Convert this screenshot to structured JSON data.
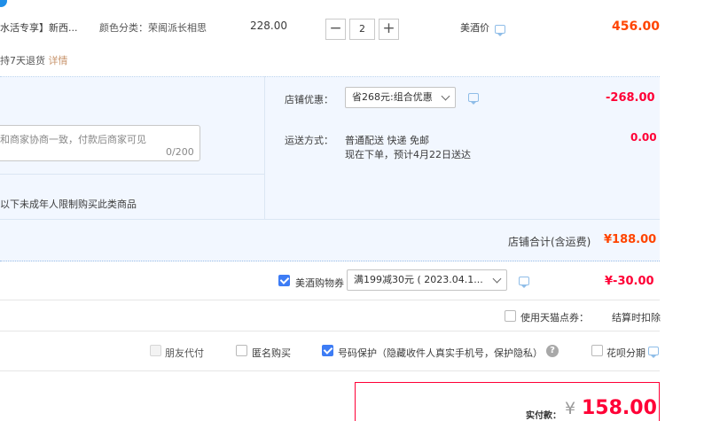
{
  "product": {
    "title": "水活专享】新西...",
    "sku": "颜色分类：荣阁派长相思",
    "unit_price": "228.00",
    "quantity": "2",
    "price_label": "美酒价",
    "subtotal": "456.00",
    "return_policy": "持7天退货",
    "return_detail": "详情",
    "minus": "−",
    "plus": "+"
  },
  "message": {
    "placeholder": "和商家协商一致，付款后商家可见",
    "count": "0/200"
  },
  "notice": "以下未成年人限制购买此类商品",
  "shop_discount": {
    "label": "店铺优惠：",
    "selected": "省268元:组合优惠",
    "amount": "-268.00"
  },
  "shipping": {
    "label": "运送方式：",
    "method": "普通配送 快递 免邮",
    "eta": "现在下单，预计4月22日送达",
    "amount": "0.00"
  },
  "shop_total": {
    "label": "店铺合计(含运费)",
    "amount": "¥188.00"
  },
  "coupon": {
    "label": "美酒购物券",
    "selected": "满199减30元 ( 2023.04.1...",
    "amount": "¥-30.00",
    "checked": true
  },
  "points": {
    "label": "使用天猫点券：",
    "note": "结算时扣除"
  },
  "options": [
    {
      "label": "朋友代付",
      "checked": false,
      "disabled": true
    },
    {
      "label": "匿名购买",
      "checked": false,
      "disabled": false
    },
    {
      "label": "号码保护（隐藏收件人真实手机号，保护隐私）",
      "checked": true,
      "disabled": false
    },
    {
      "label": "花呗分期",
      "checked": false,
      "disabled": false
    }
  ],
  "help_icon_text": "?",
  "payment": {
    "label": "实付款：",
    "currency": "¥",
    "amount": "158.00"
  },
  "colors": {
    "accent_red": "#ff0036",
    "orange": "#ff4400",
    "blue_bg": "#f2f7ff",
    "checkbox_blue": "#3d7cf5"
  }
}
